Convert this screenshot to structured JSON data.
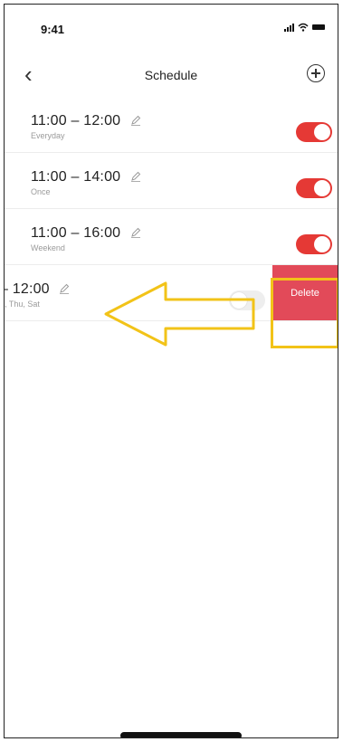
{
  "status_bar": {
    "time": "9:41"
  },
  "navbar": {
    "title": "Schedule"
  },
  "schedules": [
    {
      "time_range": "11:00 – 12:00",
      "repeat": "Everyday",
      "enabled": true
    },
    {
      "time_range": "11:00 – 14:00",
      "repeat": "Once",
      "enabled": true
    },
    {
      "time_range": "11:00 – 16:00",
      "repeat": "Weekend",
      "enabled": true
    },
    {
      "time_range": "– 12:00",
      "repeat": "e, Thu, Sat",
      "enabled": false
    }
  ],
  "swipe_action": {
    "delete_label": "Delete"
  },
  "colors": {
    "toggle_on": "#e53935",
    "delete": "#e24a59",
    "highlight": "#f2c318"
  }
}
